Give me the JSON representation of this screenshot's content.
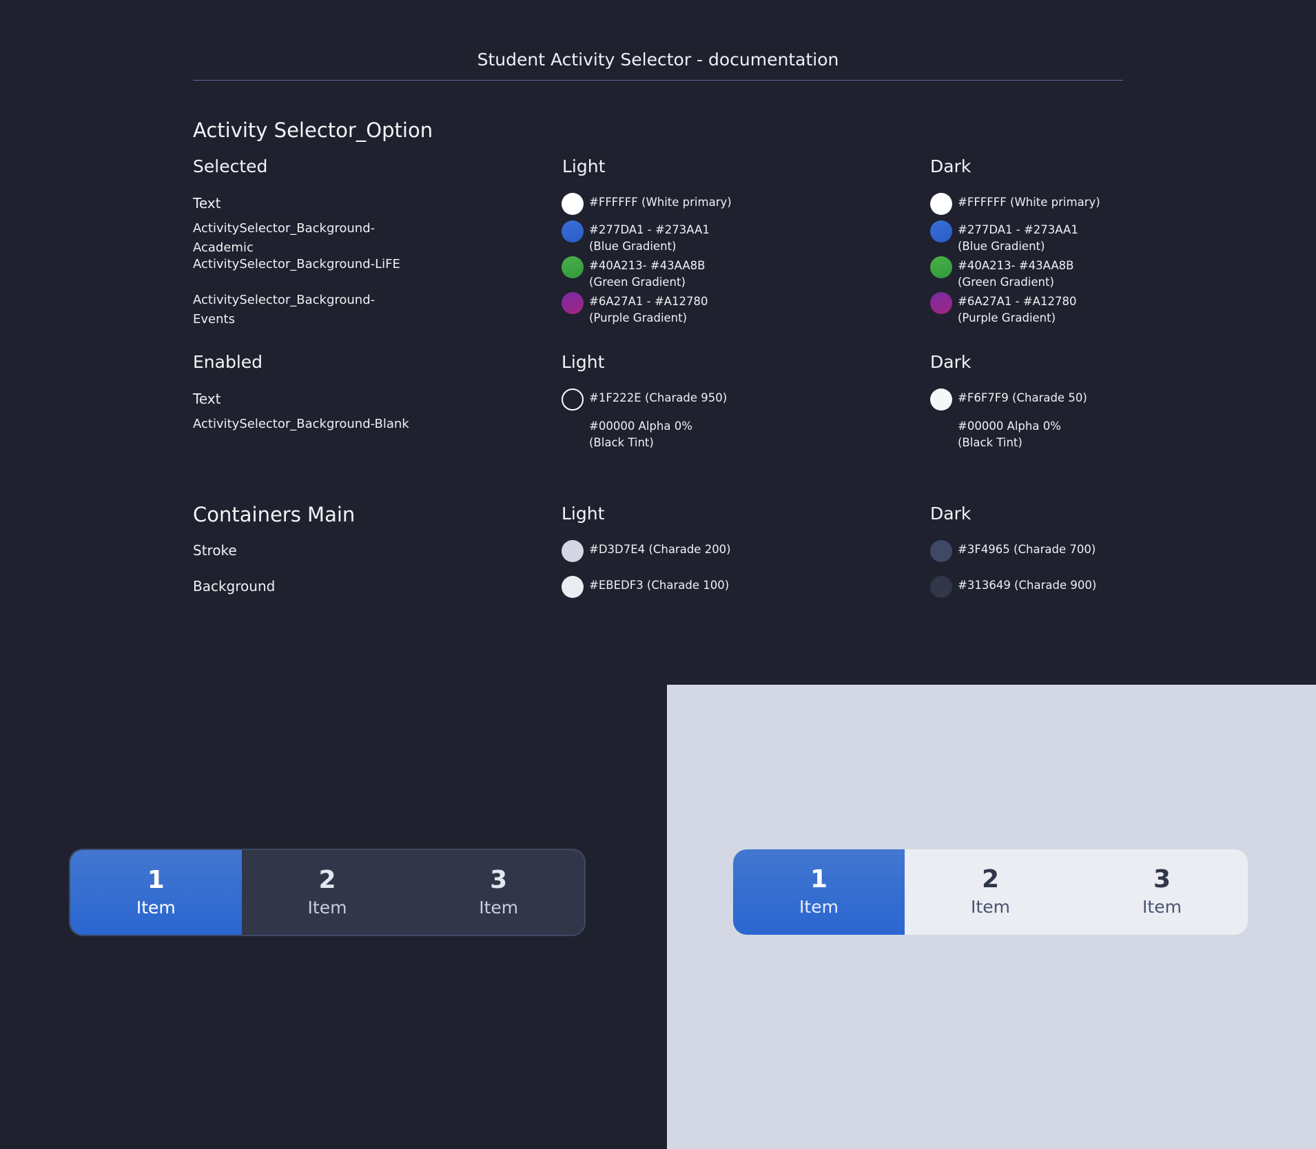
{
  "doc_title": "Student Activity Selector - documentation",
  "option_section": {
    "title": "Activity Selector_Option",
    "selected": {
      "heading": "Selected",
      "light_heading": "Light",
      "dark_heading": "Dark",
      "rows": [
        {
          "label": "Text",
          "light": {
            "text": "#FFFFFF (White primary)",
            "color": "#FFFFFF"
          },
          "dark": {
            "text": "#FFFFFF (White primary)",
            "color": "#FFFFFF"
          }
        },
        {
          "label": "ActivitySelector_Background-Academic",
          "light": {
            "text": "#277DA1 - #273AA1\n(Blue Gradient)",
            "color": "#2A66D0"
          },
          "dark": {
            "text": "#277DA1 - #273AA1\n(Blue Gradient)",
            "color": "#2A66D0"
          }
        },
        {
          "label": "ActivitySelector_Background-LiFE",
          "light": {
            "text": "#40A213- #43AA8B\n(Green Gradient)",
            "color": "#3FA43A"
          },
          "dark": {
            "text": "#40A213- #43AA8B\n(Green Gradient)",
            "color": "#3FA43A"
          }
        },
        {
          "label": "ActivitySelector_Background-Events",
          "light": {
            "text": "#6A27A1 - #A12780\n(Purple Gradient)",
            "color": "#8A2796"
          },
          "dark": {
            "text": "#6A27A1 - #A12780\n(Purple Gradient)",
            "color": "#8A2796"
          }
        }
      ]
    },
    "enabled": {
      "heading": "Enabled",
      "light_heading": "Light",
      "dark_heading": "Dark",
      "rows": [
        {
          "label": "Text",
          "light": {
            "text": "#1F222E (Charade 950)",
            "color": "#1F222E"
          },
          "dark": {
            "text": "#F6F7F9 (Charade 50)",
            "color": "#F6F7F9"
          }
        },
        {
          "label": "ActivitySelector_Background-Blank",
          "light": {
            "text": "#00000 Alpha 0%\n(Black Tint)"
          },
          "dark": {
            "text": "#00000 Alpha 0%\n(Black Tint)"
          }
        }
      ]
    }
  },
  "containers_section": {
    "title": "Containers Main",
    "light_heading": "Light",
    "dark_heading": "Dark",
    "rows": [
      {
        "label": "Stroke",
        "light": {
          "text": "#D3D7E4 (Charade 200)",
          "color": "#D3D7E4"
        },
        "dark": {
          "text": "#3F4965 (Charade 700)",
          "color": "#3F4965"
        }
      },
      {
        "label": "Background",
        "light": {
          "text": "#EBEDF3 (Charade 100)",
          "color": "#EBEDF3"
        },
        "dark": {
          "text": "#313649 (Charade 900)",
          "color": "#313649"
        }
      }
    ]
  },
  "selector_dark": {
    "items": [
      {
        "number": "1",
        "label": "Item",
        "selected": true
      },
      {
        "number": "2",
        "label": "Item",
        "selected": false
      },
      {
        "number": "3",
        "label": "Item",
        "selected": false
      }
    ]
  },
  "selector_light": {
    "items": [
      {
        "number": "1",
        "label": "Item",
        "selected": true
      },
      {
        "number": "2",
        "label": "Item",
        "selected": false
      },
      {
        "number": "3",
        "label": "Item",
        "selected": false
      }
    ]
  }
}
